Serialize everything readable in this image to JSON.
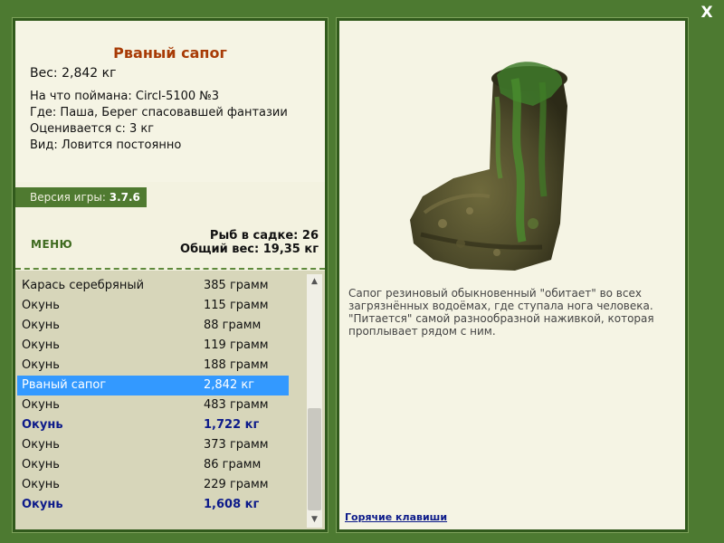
{
  "close_label": "X",
  "fish": {
    "title": "Рваный сапог",
    "weight": "Вес: 2,842 кг",
    "details": [
      "На что поймана: Circl-5100 №3",
      "Где: Паша, Берег спасовавшей фантазии",
      "Оценивается с: 3 кг",
      "Вид: Ловится постоянно"
    ]
  },
  "version": {
    "label": "Версия игры:",
    "value": "3.7.6"
  },
  "menu_label": "МЕНЮ",
  "stats": {
    "in_net": "Рыб в садке: 26",
    "total_weight": "Общий вес: 19,35 кг"
  },
  "catch_list": [
    {
      "name": "Карась серебряный",
      "weight": "385 грамм",
      "style": "normal"
    },
    {
      "name": "Окунь",
      "weight": "115 грамм",
      "style": "normal"
    },
    {
      "name": "Окунь",
      "weight": "88 грамм",
      "style": "normal"
    },
    {
      "name": "Окунь",
      "weight": "119 грамм",
      "style": "normal"
    },
    {
      "name": "Окунь",
      "weight": "188 грамм",
      "style": "normal"
    },
    {
      "name": "Рваный сапог",
      "weight": "2,842 кг",
      "style": "selected"
    },
    {
      "name": "Окунь",
      "weight": "483 грамм",
      "style": "normal"
    },
    {
      "name": "Окунь",
      "weight": "1,722 кг",
      "style": "bold"
    },
    {
      "name": "Окунь",
      "weight": "373 грамм",
      "style": "normal"
    },
    {
      "name": "Окунь",
      "weight": "86 грамм",
      "style": "normal"
    },
    {
      "name": "Окунь",
      "weight": "229 грамм",
      "style": "normal"
    },
    {
      "name": "Окунь",
      "weight": "1,608 кг",
      "style": "bold"
    }
  ],
  "description": "Сапог резиновый обыкновенный \"обитает\" во всех загрязнённых водоёмах, где ступала нога человека. \"Питается\" самой разнообразной наживкой, которая проплывает рядом с ним.",
  "hotkeys_label": "Горячие клавиши",
  "icons": {
    "close": "close-icon",
    "scroll_up": "chevron-up-icon",
    "scroll_down": "chevron-down-icon"
  },
  "colors": {
    "frame": "#4d7a31",
    "title": "#a83b06",
    "selected": "#3399ff",
    "bold_row": "#0d1b8a"
  }
}
